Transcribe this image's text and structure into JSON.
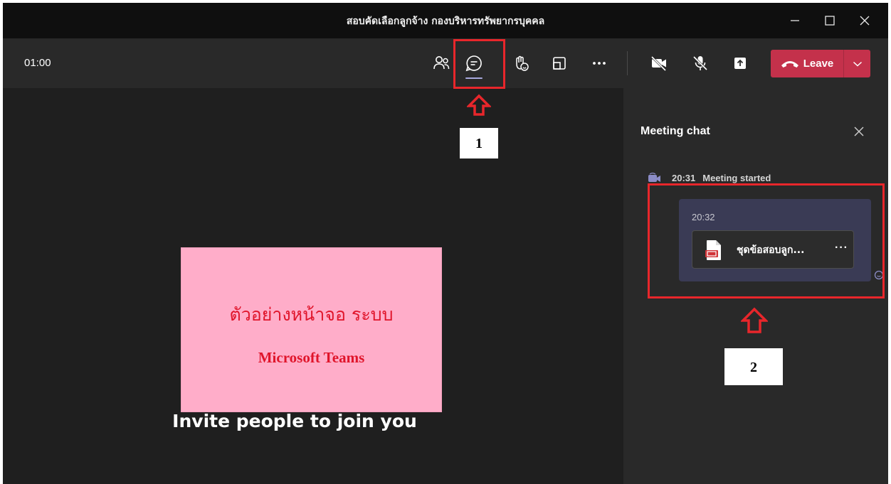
{
  "window": {
    "title": "สอบคัดเลือกลูกจ้าง กองบริหารทรัพยากรบุคคล"
  },
  "toolbar": {
    "timer": "01:00",
    "leave_label": "Leave",
    "icons": [
      "people-icon",
      "chat-icon",
      "raise-hand-icon",
      "view-icon",
      "more-icon",
      "camera-off-icon",
      "mic-off-icon",
      "share-icon"
    ]
  },
  "stage": {
    "invite_text": "Invite people to join you"
  },
  "chat": {
    "title": "Meeting chat",
    "event_time": "20:31",
    "event_text": "Meeting started",
    "message_time": "20:32",
    "file_name": "ชุดข้อสอบลูก...",
    "file_more": "···"
  },
  "annotations": {
    "note_line1": "ตัวอย่างหน้าจอ ระบบ",
    "note_line2": "Microsoft Teams",
    "label_1": "1",
    "label_2": "2"
  },
  "colors": {
    "leave": "#c4314b",
    "annotation_red": "#e8262b",
    "note_bg": "#ffadc9",
    "accent": "#a6a7dc"
  }
}
